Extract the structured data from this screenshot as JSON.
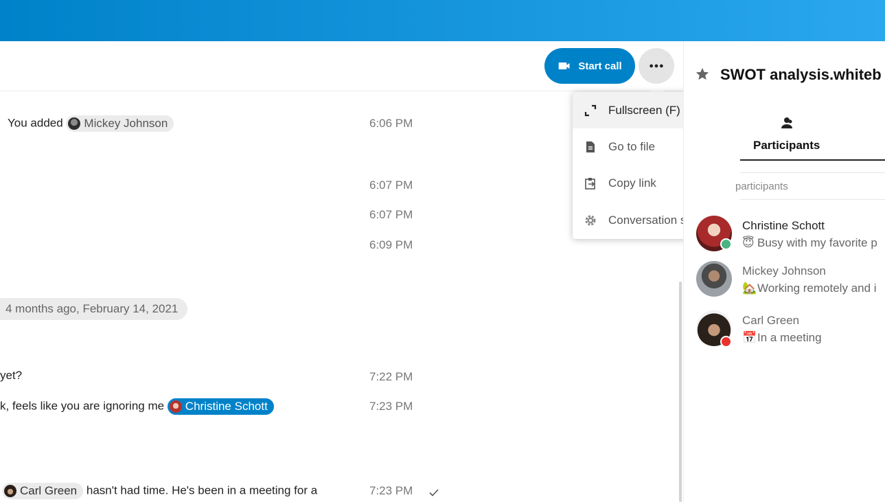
{
  "header": {
    "start_call_label": "Start call",
    "more_menu": [
      {
        "label": "Fullscreen (F)",
        "icon": "fullscreen-icon"
      },
      {
        "label": "Go to file",
        "icon": "file-icon"
      },
      {
        "label": "Copy link",
        "icon": "clipboard-icon"
      },
      {
        "label": "Conversation settings",
        "icon": "gear-icon"
      }
    ]
  },
  "messages": {
    "m1": {
      "prefix": "You added",
      "mention": "Mickey Johnson",
      "time": "6:06 PM"
    },
    "m2": {
      "time": "6:07 PM"
    },
    "m3": {
      "time": "6:07 PM"
    },
    "m4": {
      "time": "6:09 PM"
    },
    "date_separator": "4 months ago, February 14, 2021",
    "m5": {
      "text": "yet?",
      "time": "7:22 PM"
    },
    "m6": {
      "text": "k, feels like you are ignoring me",
      "mention": "Christine Schott",
      "time": "7:23 PM"
    },
    "m7": {
      "mention": "Carl Green",
      "text": "hasn't had time. He's been in a meeting for a",
      "time": "7:23 PM"
    }
  },
  "sidebar": {
    "title": "SWOT analysis.whiteb",
    "tab_label": "Participants",
    "participants_label": "participants",
    "participants": [
      {
        "name": "Christine Schott",
        "status_emoji": "😇",
        "status": "Busy with my favorite p",
        "presence": "online"
      },
      {
        "name": "Mickey Johnson",
        "status_emoji": "🏡",
        "status": "Working remotely and i",
        "presence": "away"
      },
      {
        "name": "Carl Green",
        "status_emoji": "📅",
        "status": "In a meeting",
        "presence": "dnd"
      }
    ]
  },
  "colors": {
    "primary": "#0082c9",
    "online": "#49b382",
    "dnd": "#e9322d"
  }
}
